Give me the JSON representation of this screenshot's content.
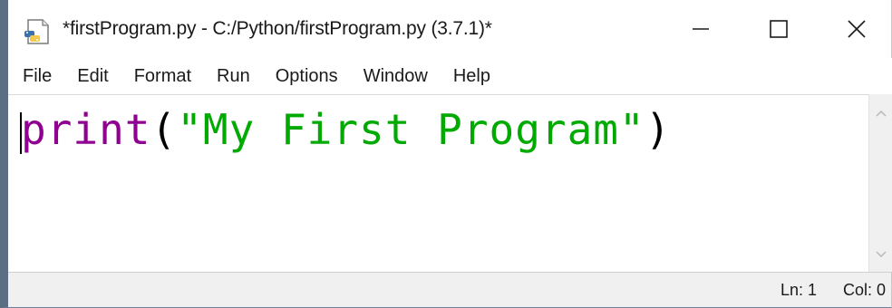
{
  "window": {
    "title": "*firstProgram.py - C:/Python/firstProgram.py (3.7.1)*",
    "icon": "python-file-icon"
  },
  "controls": {
    "minimize_icon": "minimize-icon",
    "maximize_icon": "maximize-icon",
    "close_icon": "close-icon"
  },
  "menu": {
    "items": [
      "File",
      "Edit",
      "Format",
      "Run",
      "Options",
      "Window",
      "Help"
    ]
  },
  "editor": {
    "tokens": {
      "builtin": "print",
      "open_paren": "(",
      "string": "\"My First Program\"",
      "close_paren": ")"
    },
    "colors": {
      "builtin": "#900090",
      "string": "#00aa00",
      "plain": "#000000"
    }
  },
  "status": {
    "line": "Ln: 1",
    "column": "Col: 0"
  }
}
